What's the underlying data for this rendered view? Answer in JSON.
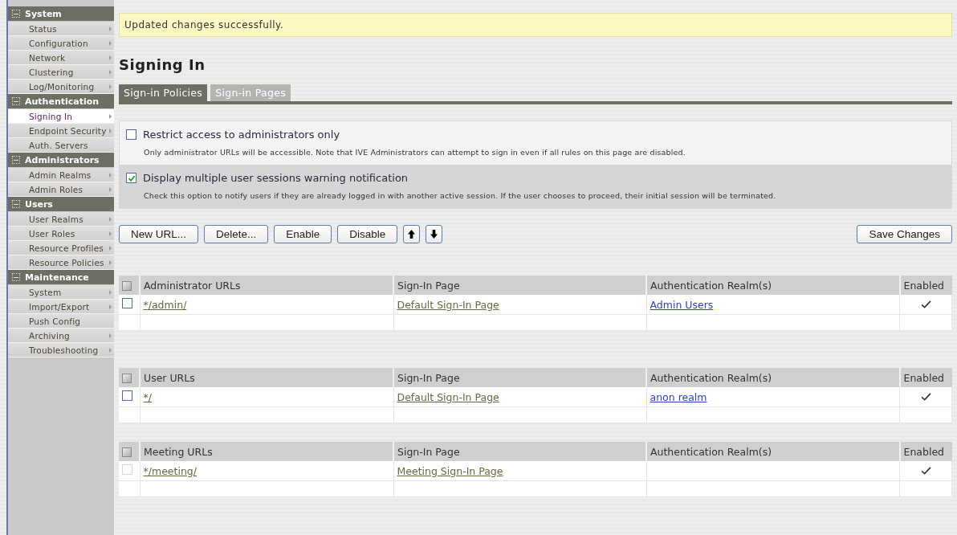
{
  "sidebar": {
    "sections": [
      {
        "title": "System",
        "expanded": true,
        "items": [
          {
            "label": "Status",
            "selected": false,
            "has_submenu": true
          },
          {
            "label": "Configuration",
            "selected": false,
            "has_submenu": true
          },
          {
            "label": "Network",
            "selected": false,
            "has_submenu": true
          },
          {
            "label": "Clustering",
            "selected": false,
            "has_submenu": true
          },
          {
            "label": "Log/Monitoring",
            "selected": false,
            "has_submenu": true
          }
        ]
      },
      {
        "title": "Authentication",
        "expanded": true,
        "items": [
          {
            "label": "Signing In",
            "selected": true,
            "has_submenu": true
          },
          {
            "label": "Endpoint Security",
            "selected": false,
            "has_submenu": true
          },
          {
            "label": "Auth. Servers",
            "selected": false,
            "has_submenu": false
          }
        ]
      },
      {
        "title": "Administrators",
        "expanded": true,
        "items": [
          {
            "label": "Admin Realms",
            "selected": false,
            "has_submenu": true
          },
          {
            "label": "Admin Roles",
            "selected": false,
            "has_submenu": true
          }
        ]
      },
      {
        "title": "Users",
        "expanded": true,
        "items": [
          {
            "label": "User Realms",
            "selected": false,
            "has_submenu": true
          },
          {
            "label": "User Roles",
            "selected": false,
            "has_submenu": true
          },
          {
            "label": "Resource Profiles",
            "selected": false,
            "has_submenu": true
          },
          {
            "label": "Resource Policies",
            "selected": false,
            "has_submenu": true
          }
        ]
      },
      {
        "title": "Maintenance",
        "expanded": true,
        "items": [
          {
            "label": "System",
            "selected": false,
            "has_submenu": true
          },
          {
            "label": "Import/Export",
            "selected": false,
            "has_submenu": true
          },
          {
            "label": "Push Config",
            "selected": false,
            "has_submenu": false
          },
          {
            "label": "Archiving",
            "selected": false,
            "has_submenu": true
          },
          {
            "label": "Troubleshooting",
            "selected": false,
            "has_submenu": true
          }
        ]
      }
    ]
  },
  "notice": "Updated changes successfully.",
  "page_title": "Signing In",
  "tabs": [
    {
      "label": "Sign-in Policies",
      "selected": true
    },
    {
      "label": "Sign-in Pages",
      "selected": false
    }
  ],
  "options": [
    {
      "label": "Restrict access to administrators only",
      "description": "Only administrator URLs will be accessible. Note that IVE Administrators can attempt to sign in even if all rules on this page are disabled.",
      "checked": false
    },
    {
      "label": "Display multiple user sessions warning notification",
      "description": "Check this option to notify users if they are already logged in with another active session. If the user chooses to proceed, their initial session will be terminated.",
      "checked": true
    }
  ],
  "toolbar": [
    {
      "kind": "text",
      "label": "New URL..."
    },
    {
      "kind": "text",
      "label": "Delete..."
    },
    {
      "kind": "text",
      "label": "Enable"
    },
    {
      "kind": "text",
      "label": "Disable"
    },
    {
      "kind": "up"
    },
    {
      "kind": "down"
    }
  ],
  "save_button": "Save Changes",
  "tables": [
    {
      "columns": [
        "Administrator URLs",
        "Sign-In Page",
        "Authentication Realm(s)",
        "Enabled"
      ],
      "rows": [
        {
          "url": "*/admin/",
          "sign_in_page": "Default Sign-In Page",
          "realm": "Admin Users",
          "enabled": true,
          "disabled": false
        }
      ]
    },
    {
      "columns": [
        "User URLs",
        "Sign-In Page",
        "Authentication Realm(s)",
        "Enabled"
      ],
      "rows": [
        {
          "url": "*/",
          "sign_in_page": "Default Sign-In Page",
          "realm": "anon realm",
          "enabled": true,
          "disabled": false
        }
      ]
    },
    {
      "columns": [
        "Meeting URLs",
        "Sign-In Page",
        "Authentication Realm(s)",
        "Enabled"
      ],
      "rows": [
        {
          "url": "*/meeting/",
          "sign_in_page": "Meeting Sign-In Page",
          "enabled": true,
          "disabled": true
        }
      ]
    }
  ]
}
